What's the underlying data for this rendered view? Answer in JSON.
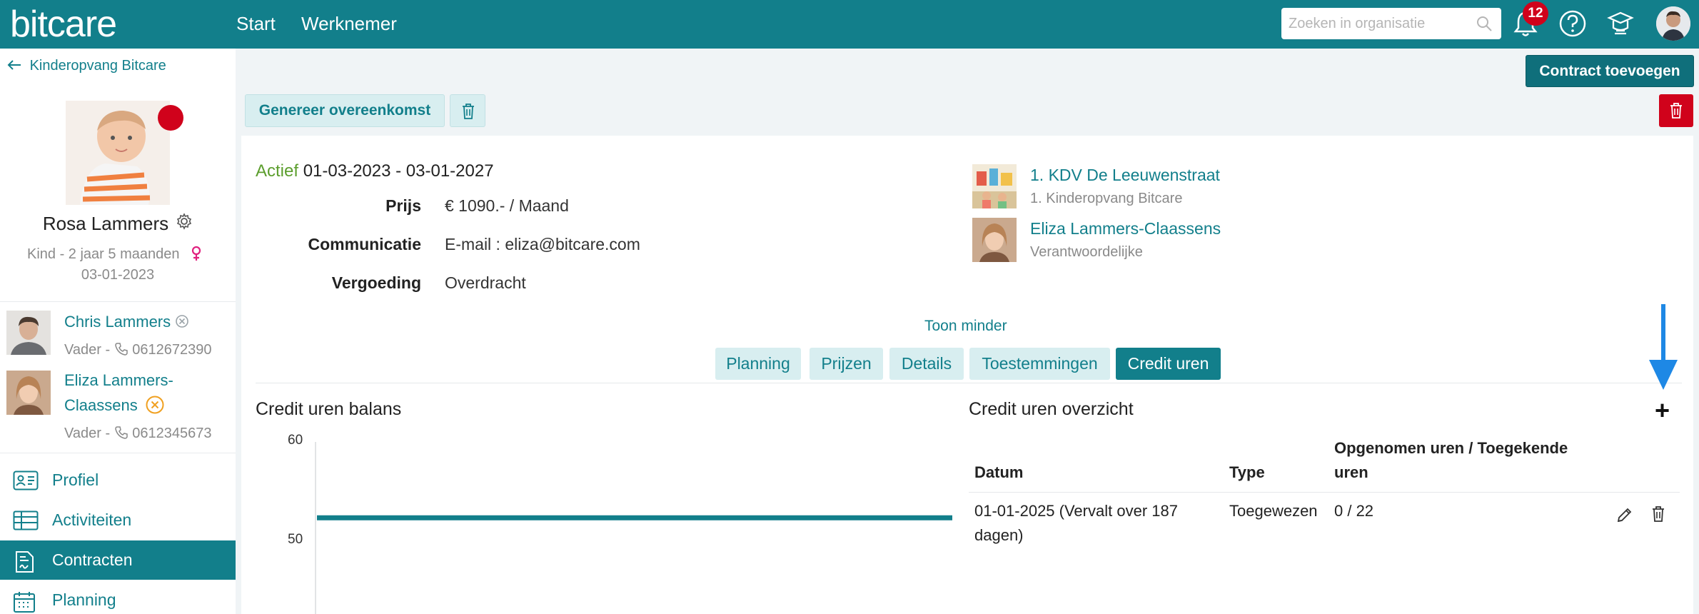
{
  "header": {
    "logo": "bitcare",
    "nav": [
      "Start",
      "Werknemer"
    ],
    "search_placeholder": "Zoeken in organisatie",
    "notification_count": "12"
  },
  "sidebar": {
    "back_label": "Kinderopvang Bitcare",
    "child_name": "Rosa Lammers",
    "child_info": "Kind - 2 jaar 5 maanden",
    "child_date": "03-01-2023",
    "contacts": [
      {
        "name": "Chris Lammers",
        "sub": "Vader - ",
        "phone": "0612672390"
      },
      {
        "name_line1": "Eliza Lammers-",
        "name_line2": "Claassens",
        "sub": "Vader - ",
        "phone": "0612345673"
      }
    ],
    "menu": [
      "Profiel",
      "Activiteiten",
      "Contracten",
      "Planning"
    ],
    "active_menu": "Contracten"
  },
  "toolbar": {
    "add_contract": "Contract toevoegen",
    "generate": "Genereer overeenkomst"
  },
  "contract": {
    "status": "Actief",
    "period": "01-03-2023 - 03-01-2027",
    "fields": [
      {
        "label": "Prijs",
        "value": "€ 1090.- / Maand"
      },
      {
        "label": "Communicatie",
        "value": "E-mail : eliza@bitcare.com"
      },
      {
        "label": "Vergoeding",
        "value": "Overdracht"
      }
    ],
    "location": {
      "title": "1. KDV De Leeuwenstraat",
      "sub": "1. Kinderopvang Bitcare"
    },
    "responsible": {
      "title": "Eliza Lammers-Claassens",
      "sub": "Verantwoordelijke"
    },
    "toggle_label": "Toon minder",
    "tabs": [
      "Planning",
      "Prijzen",
      "Details",
      "Toestemmingen",
      "Credit uren"
    ],
    "active_tab": "Credit uren"
  },
  "credit": {
    "balance_title": "Credit uren balans",
    "overview_title": "Credit uren overzicht",
    "columns": [
      "Datum",
      "Type",
      "Opgenomen uren / Toegekende",
      "uren"
    ],
    "rows": [
      {
        "date_line1": "01-01-2025 (Vervalt over 187",
        "date_line2": "dagen)",
        "type": "Toegewezen",
        "hours": "0 / 22"
      }
    ]
  },
  "chart_data": {
    "type": "line",
    "title": "Credit uren balans",
    "y_ticks": [
      "60",
      "50"
    ],
    "ylim": [
      45,
      60
    ],
    "series": [
      {
        "values": [
          52.3,
          52.3
        ]
      }
    ]
  },
  "colors": {
    "primary": "#127f8b",
    "danger": "#d0021b",
    "active_status": "#5c9e2e",
    "arrow": "#1e88e5"
  }
}
